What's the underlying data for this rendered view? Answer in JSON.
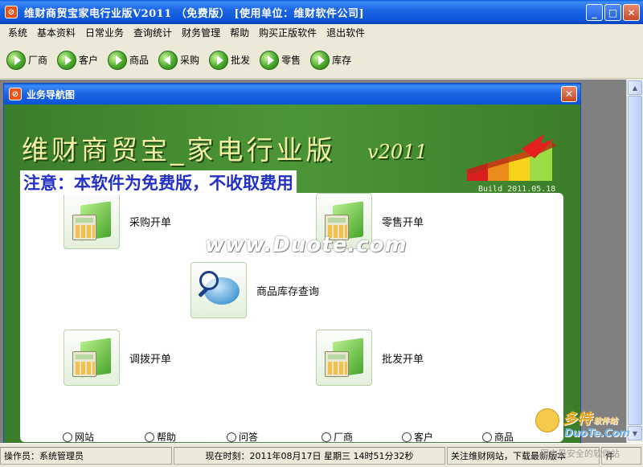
{
  "window": {
    "title": "维财商贸宝家电行业版V2011  （免费版）   [使用单位：维财软件公司]",
    "icon": "app-logo-icon"
  },
  "menu": [
    "系统",
    "基本资料",
    "日常业务",
    "查询统计",
    "财务管理",
    "帮助",
    "购买正版软件",
    "退出软件"
  ],
  "toolbar": [
    {
      "label": "厂商",
      "icon": "arrow-right-icon"
    },
    {
      "label": "客户",
      "icon": "arrow-right-icon"
    },
    {
      "label": "商品",
      "icon": "arrow-right-icon"
    },
    {
      "label": "采购",
      "icon": "arrow-left-icon"
    },
    {
      "label": "批发",
      "icon": "arrow-right-icon"
    },
    {
      "label": "零售",
      "icon": "arrow-right-icon"
    },
    {
      "label": "库存",
      "icon": "arrow-right-icon"
    }
  ],
  "child_window": {
    "title": "业务导航图",
    "brand_title": "维财商贸宝_家电行业版",
    "brand_version": "v2011",
    "build": "Build 2011.05.18",
    "notice": "注意：本软件为免费版，不收取费用",
    "tiles": [
      {
        "label": "采购开单",
        "icon": "folder-calculator-icon"
      },
      {
        "label": "零售开单",
        "icon": "folder-calculator-icon"
      },
      {
        "label": "商品库存查询",
        "icon": "magnifier-disk-icon"
      },
      {
        "label": "调拨开单",
        "icon": "folder-calculator-icon"
      },
      {
        "label": "批发开单",
        "icon": "folder-calculator-icon"
      }
    ],
    "watermark": "www.Duote.com",
    "radios": [
      "网站",
      "帮助",
      "问答",
      "厂商",
      "客户",
      "商品"
    ]
  },
  "status": {
    "operator": "操作员：系统管理员",
    "time": "现在时刻：2011年08月17日  星期三  14时51分32秒",
    "notice": "关注维财网站，下载最新版本",
    "extra": "件"
  },
  "corner_watermark": {
    "line1": "多特",
    "line1_small": "软件站",
    "line2": "DuoTe.Com",
    "line3": "国内最安全的软件站"
  },
  "colors": {
    "titlebar": "#0b53d6",
    "banner_green": "#3d8c2e",
    "notice_blue": "#2230c8",
    "brand_yellow": "#f2efa5"
  }
}
